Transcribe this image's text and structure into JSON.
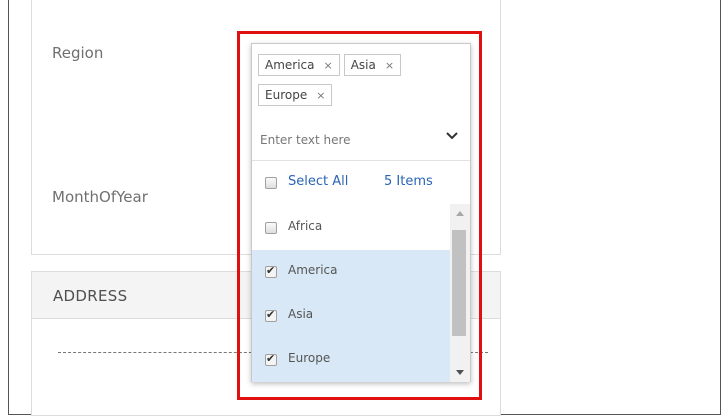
{
  "form": {
    "region_label": "Region",
    "month_label": "MonthOfYear",
    "address_title": "ADDRESS"
  },
  "dropdown": {
    "tags": [
      {
        "label": "America"
      },
      {
        "label": "Asia"
      },
      {
        "label": "Europe"
      }
    ],
    "tag_remove_symbol": "×",
    "placeholder": "Enter text here",
    "select_all_label": "Select All",
    "count_label": "5 Items",
    "items": [
      {
        "label": "Africa",
        "checked": false
      },
      {
        "label": "America",
        "checked": true
      },
      {
        "label": "Asia",
        "checked": true
      },
      {
        "label": "Europe",
        "checked": true
      }
    ],
    "icons": {
      "toggle": "chevron-down-icon",
      "scroll_up": "scroll-up-arrow-icon",
      "scroll_down": "scroll-down-arrow-icon"
    }
  },
  "colors": {
    "link": "#2a64b4",
    "selected_row": "#d8e8f6",
    "highlight_border": "#e01010"
  }
}
